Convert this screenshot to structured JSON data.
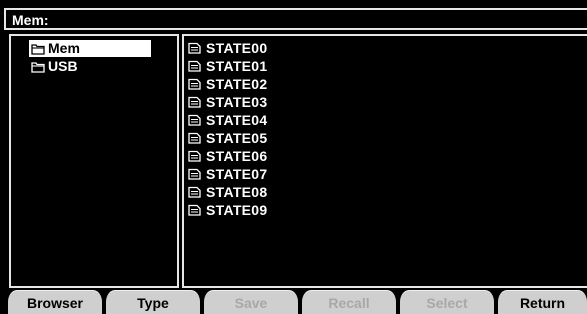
{
  "title": "Mem:",
  "folders": [
    {
      "label": "Mem",
      "selected": true,
      "icon": "folder-icon"
    },
    {
      "label": "USB",
      "selected": false,
      "icon": "folder-icon"
    }
  ],
  "files": [
    {
      "label": "STATE00",
      "icon": "file-icon"
    },
    {
      "label": "STATE01",
      "icon": "file-icon"
    },
    {
      "label": "STATE02",
      "icon": "file-icon"
    },
    {
      "label": "STATE03",
      "icon": "file-icon"
    },
    {
      "label": "STATE04",
      "icon": "file-icon"
    },
    {
      "label": "STATE05",
      "icon": "file-icon"
    },
    {
      "label": "STATE06",
      "icon": "file-icon"
    },
    {
      "label": "STATE07",
      "icon": "file-icon"
    },
    {
      "label": "STATE08",
      "icon": "file-icon"
    },
    {
      "label": "STATE09",
      "icon": "file-icon"
    }
  ],
  "softkeys": [
    {
      "label": "Browser",
      "enabled": true
    },
    {
      "label": "Type",
      "enabled": true
    },
    {
      "label": "Save",
      "enabled": false
    },
    {
      "label": "Recall",
      "enabled": false
    },
    {
      "label": "Select",
      "enabled": false
    },
    {
      "label": "Return",
      "enabled": true
    }
  ],
  "colors": {
    "background": "#000000",
    "foreground": "#ffffff",
    "softkey_bg": "#cfcfcf",
    "softkey_disabled_text": "#a8a8a8"
  }
}
